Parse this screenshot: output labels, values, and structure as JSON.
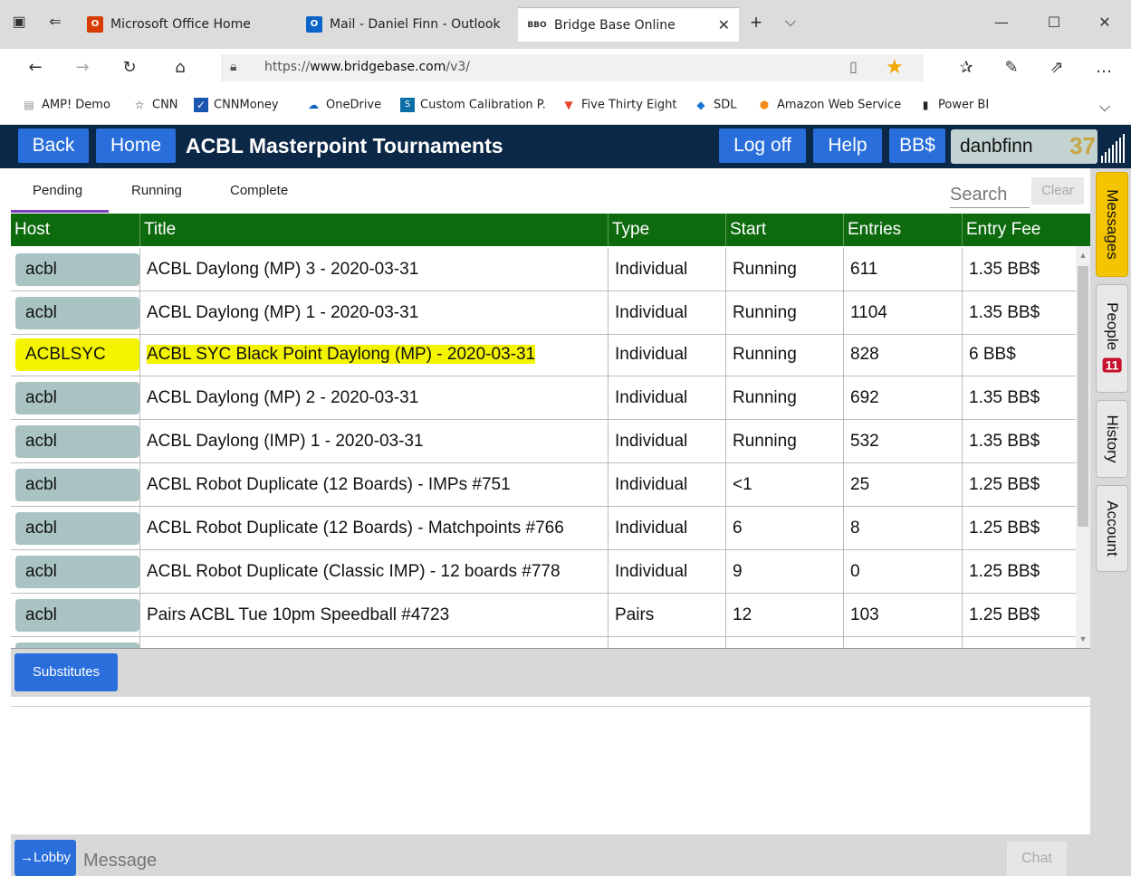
{
  "browser": {
    "tabs": [
      {
        "label": "Microsoft Office Home",
        "icon": "office-icon"
      },
      {
        "label": "Mail - Daniel Finn - Outlook",
        "icon": "outlook-icon"
      },
      {
        "label": "Bridge Base Online",
        "icon": "bbo-icon",
        "active": true
      }
    ],
    "url_prefix": "https://",
    "url_host": "www.bridgebase.com",
    "url_path": "/v3/",
    "favorites": [
      {
        "label": "AMP! Demo",
        "icon": "document-icon"
      },
      {
        "label": "CNN",
        "icon": "star-outline-icon"
      },
      {
        "label": "CNNMoney",
        "icon": "chart-icon"
      },
      {
        "label": "OneDrive",
        "icon": "cloud-icon"
      },
      {
        "label": "Custom Calibration P.",
        "icon": "sharepoint-icon"
      },
      {
        "label": "Five Thirty Eight",
        "icon": "fox-icon"
      },
      {
        "label": "SDL",
        "icon": "diamond-icon"
      },
      {
        "label": "Amazon Web Service",
        "icon": "aws-icon"
      },
      {
        "label": "Power BI",
        "icon": "powerbi-icon"
      }
    ]
  },
  "header": {
    "back_label": "Back",
    "home_label": "Home",
    "title": "ACBL Masterpoint Tournaments",
    "logoff_label": "Log off",
    "help_label": "Help",
    "bbdollar_label": "BB$",
    "username": "danbfinn",
    "points": "37"
  },
  "subtabs": {
    "pending": "Pending",
    "running": "Running",
    "complete": "Complete",
    "search_placeholder": "Search",
    "clear_label": "Clear"
  },
  "table": {
    "columns": [
      "Host",
      "Title",
      "Type",
      "Start",
      "Entries",
      "Entry Fee"
    ],
    "rows": [
      {
        "host": "acbl",
        "title": "ACBL Daylong (MP) 3 - 2020-03-31",
        "type": "Individual",
        "start": "Running",
        "entries": "611",
        "fee": "1.35 BB$"
      },
      {
        "host": "acbl",
        "title": "ACBL Daylong (MP) 1 - 2020-03-31",
        "type": "Individual",
        "start": "Running",
        "entries": "1104",
        "fee": "1.35 BB$"
      },
      {
        "host": "ACBLSYC",
        "title": "ACBL SYC Black Point Daylong (MP) - 2020-03-31",
        "type": "Individual",
        "start": "Running",
        "entries": "828",
        "fee": "6 BB$",
        "highlight": true
      },
      {
        "host": "acbl",
        "title": "ACBL Daylong (MP) 2 - 2020-03-31",
        "type": "Individual",
        "start": "Running",
        "entries": "692",
        "fee": "1.35 BB$"
      },
      {
        "host": "acbl",
        "title": "ACBL Daylong (IMP) 1 - 2020-03-31",
        "type": "Individual",
        "start": "Running",
        "entries": "532",
        "fee": "1.35 BB$"
      },
      {
        "host": "acbl",
        "title": "ACBL Robot Duplicate (12 Boards) - IMPs #751",
        "type": "Individual",
        "start": "<1",
        "entries": "25",
        "fee": "1.25 BB$"
      },
      {
        "host": "acbl",
        "title": "ACBL Robot Duplicate (12 Boards) - Matchpoints #766",
        "type": "Individual",
        "start": "6",
        "entries": "8",
        "fee": "1.25 BB$"
      },
      {
        "host": "acbl",
        "title": "ACBL Robot Duplicate (Classic IMP) - 12 boards #778",
        "type": "Individual",
        "start": "9",
        "entries": "0",
        "fee": "1.25 BB$"
      },
      {
        "host": "acbl",
        "title": "Pairs ACBL Tue 10pm Speedball #4723",
        "type": "Pairs",
        "start": "12",
        "entries": "103",
        "fee": "1.25 BB$"
      }
    ]
  },
  "bottom": {
    "substitutes_label": "Substitutes",
    "lobby_label": "→Lobby",
    "message_placeholder": "Message",
    "chat_label": "Chat"
  },
  "side": {
    "messages": "Messages",
    "people": "People",
    "people_count": "11",
    "history": "History",
    "account": "Account"
  },
  "colors": {
    "header_bg": "#0c2847",
    "button_blue": "#2a6edb",
    "table_header": "#0d6a0d",
    "highlight": "#f4f400",
    "messages_tab": "#f5c400"
  }
}
